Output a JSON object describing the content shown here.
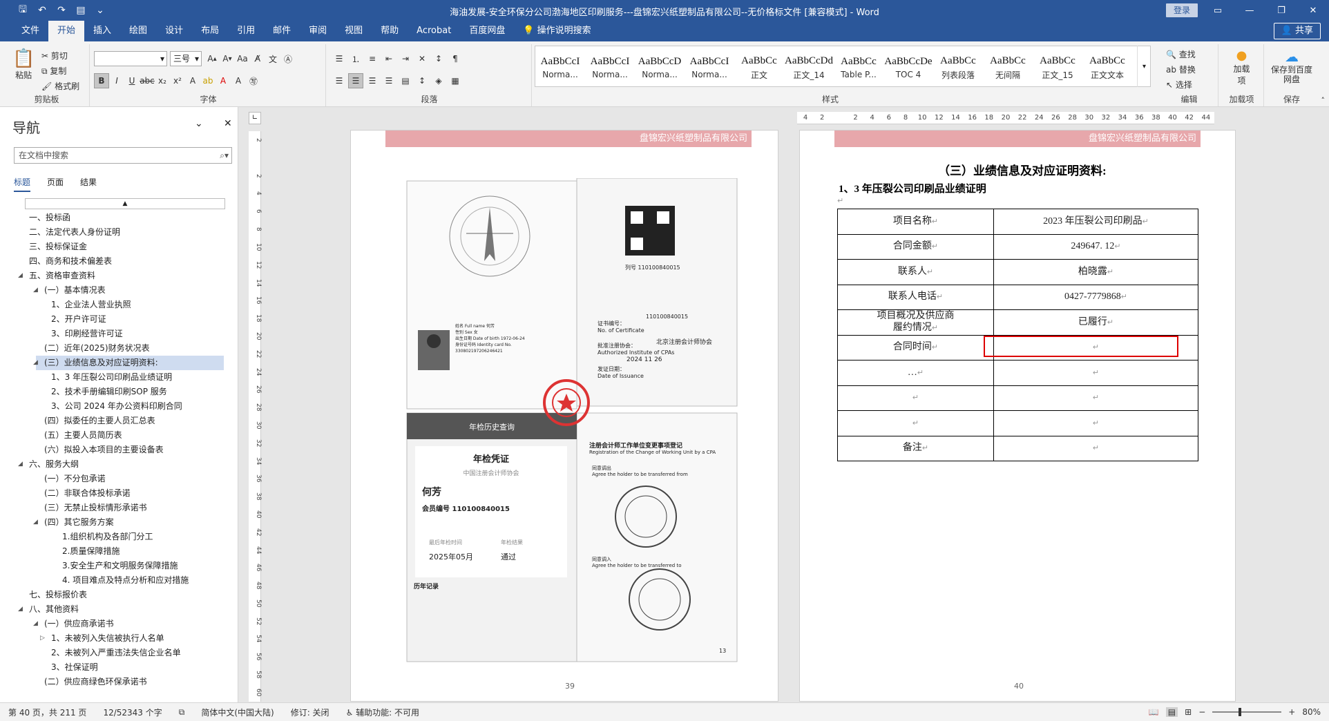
{
  "window": {
    "title": "海油发展-安全环保分公司渤海地区印刷服务---盘锦宏兴纸塑制品有限公司--无价格标文件 [兼容模式]  -  Word",
    "login_label": "登录"
  },
  "tabs": [
    "文件",
    "开始",
    "插入",
    "绘图",
    "设计",
    "布局",
    "引用",
    "邮件",
    "审阅",
    "视图",
    "帮助",
    "Acrobat",
    "百度网盘",
    "操作说明搜索"
  ],
  "share_label": "共享",
  "ribbon": {
    "clipboard": {
      "paste": "粘贴",
      "cut": "剪切",
      "copy": "复制",
      "format_painter": "格式刷",
      "label": "剪贴板"
    },
    "font": {
      "font_size": "三号",
      "label": "字体"
    },
    "paragraph": {
      "label": "段落"
    },
    "styles": {
      "label": "样式",
      "items": [
        {
          "preview": "AaBbCcI",
          "name": "Norma..."
        },
        {
          "preview": "AaBbCcI",
          "name": "Norma..."
        },
        {
          "preview": "AaBbCcD",
          "name": "Norma..."
        },
        {
          "preview": "AaBbCcI",
          "name": "Norma..."
        },
        {
          "preview": "AaBbCc",
          "name": "正文"
        },
        {
          "preview": "AaBbCcDd",
          "name": "正文_14"
        },
        {
          "preview": "AaBbCc",
          "name": "Table P..."
        },
        {
          "preview": "AaBbCcDe",
          "name": "TOC 4"
        },
        {
          "preview": "AaBbCc",
          "name": "列表段落"
        },
        {
          "preview": "AaBbCc",
          "name": "无间隔"
        },
        {
          "preview": "AaBbCc",
          "name": "正文_15"
        },
        {
          "preview": "AaBbCc",
          "name": "正文文本"
        }
      ]
    },
    "editing": {
      "find": "查找",
      "replace": "替换",
      "select": "选择",
      "label": "编辑"
    },
    "addins": {
      "addin": "加载项",
      "label": "加载项"
    },
    "baidu": {
      "save": "保存到百度网盘",
      "label": "保存"
    }
  },
  "nav": {
    "title": "导航",
    "search_placeholder": "在文档中搜索",
    "tabs": [
      "标题",
      "页面",
      "结果"
    ],
    "items": [
      {
        "text": "一、投标函",
        "level": 1,
        "tri": ""
      },
      {
        "text": "二、法定代表人身份证明",
        "level": 1,
        "tri": ""
      },
      {
        "text": "三、投标保证金",
        "level": 1,
        "tri": ""
      },
      {
        "text": "四、商务和技术偏差表",
        "level": 1,
        "tri": ""
      },
      {
        "text": "五、资格审查资料",
        "level": 1,
        "tri": "◢"
      },
      {
        "text": "(一）基本情况表",
        "level": 2,
        "tri": "◢"
      },
      {
        "text": "1、企业法人营业执照",
        "level": 3,
        "tri": ""
      },
      {
        "text": "2、开户许可证",
        "level": 3,
        "tri": ""
      },
      {
        "text": "3、印刷经营许可证",
        "level": 3,
        "tri": ""
      },
      {
        "text": "(二）近年(2025)财务状况表",
        "level": 2,
        "tri": ""
      },
      {
        "text": "(三）业绩信息及对应证明资料:",
        "level": 2,
        "tri": "◢",
        "selected": true
      },
      {
        "text": "1、3 年压裂公司印刷品业绩证明",
        "level": 3,
        "tri": ""
      },
      {
        "text": "2、技术手册编辑印刷SOP 服务",
        "level": 3,
        "tri": ""
      },
      {
        "text": "3、公司 2024 年办公资料印刷合同",
        "level": 3,
        "tri": ""
      },
      {
        "text": "(四）拟委任的主要人员汇总表",
        "level": 2,
        "tri": ""
      },
      {
        "text": "(五）主要人员简历表",
        "level": 2,
        "tri": ""
      },
      {
        "text": "(六）拟投入本项目的主要设备表",
        "level": 2,
        "tri": ""
      },
      {
        "text": "六、服务大纲",
        "level": 1,
        "tri": "◢"
      },
      {
        "text": "(一）不分包承诺",
        "level": 2,
        "tri": ""
      },
      {
        "text": "(二）非联合体投标承诺",
        "level": 2,
        "tri": ""
      },
      {
        "text": "(三）无禁止投标情形承诺书",
        "level": 2,
        "tri": ""
      },
      {
        "text": "(四）其它服务方案",
        "level": 2,
        "tri": "◢"
      },
      {
        "text": "1.组织机构及各部门分工",
        "level": 4,
        "tri": ""
      },
      {
        "text": "2.质量保障措施",
        "level": 4,
        "tri": ""
      },
      {
        "text": "3.安全生产和文明服务保障措施",
        "level": 4,
        "tri": ""
      },
      {
        "text": "4. 项目难点及特点分析和应对措施",
        "level": 4,
        "tri": ""
      },
      {
        "text": "七、投标报价表",
        "level": 1,
        "tri": ""
      },
      {
        "text": "八、其他资料",
        "level": 1,
        "tri": "◢"
      },
      {
        "text": "(一）供应商承诺书",
        "level": 2,
        "tri": "◢"
      },
      {
        "text": "1、未被列入失信被执行人名单",
        "level": 3,
        "tri": "▷"
      },
      {
        "text": "2、未被列入严重违法失信企业名单",
        "level": 3,
        "tri": ""
      },
      {
        "text": "3、社保证明",
        "level": 3,
        "tri": ""
      },
      {
        "text": "(二）供应商绿色环保承诺书",
        "level": 2,
        "tri": ""
      }
    ]
  },
  "ruler_numbers": [
    "4",
    "2",
    "",
    "2",
    "4",
    "6",
    "8",
    "10",
    "12",
    "14",
    "16",
    "18",
    "20",
    "22",
    "24",
    "26",
    "28",
    "30",
    "32",
    "34",
    "36",
    "38",
    "40",
    "42",
    "44"
  ],
  "vruler_numbers": [
    "2",
    "",
    "2",
    "4",
    "6",
    "8",
    "10",
    "12",
    "14",
    "16",
    "18",
    "20",
    "22",
    "24",
    "26",
    "28",
    "30",
    "32",
    "34",
    "36",
    "38",
    "40",
    "42",
    "44",
    "46",
    "48",
    "50",
    "52",
    "54",
    "56",
    "58",
    "60"
  ],
  "page_left": {
    "header": "盘锦宏兴纸塑制品有限公司",
    "page_number": "39",
    "cert": {
      "qr_no": "列号  110100840015",
      "cert_no_label": "证书编号：",
      "cert_no_en": "No. of Certificate",
      "cert_no": "110100840015",
      "approval_label": "批准注册协会：",
      "approval_en": "Authorized Institute of CPAs",
      "approval_org": "北京注册会计师协会",
      "issue_label": "发证日期：",
      "issue_en": "Date of Issuance",
      "issue_date": "2024   11   26",
      "name_label": "姓名 Full name",
      "name": "何芳",
      "sex_label": "性别 Sex",
      "sex": "女",
      "birth_label": "出生日期 Date of birth",
      "birth": "1972-06-24",
      "id_label": "身份证号码 Identity card No.",
      "id": "330802197206246421",
      "review_header": "年检历史查询",
      "review_title": "年检凭证",
      "review_org": "中国注册会计师协会",
      "review_name": "何芳",
      "review_member_no": "会员编号  110100840015",
      "review_last_label": "最后年检时间",
      "review_last": "2025年05月",
      "review_result_label": "年检结果",
      "review_result": "通过",
      "review_history": "历年记录",
      "change_title": "注册会计师工作单位变更事项登记",
      "change_title_en": "Registration of the Change of Working Unit by a CPA",
      "change_agree": "同意调出",
      "change_agree_en": "Agree the holder to be transferred from",
      "change_in": "同意调入",
      "change_in_en": "Agree the holder to be transferred to",
      "page_mark": "13"
    }
  },
  "page_right": {
    "header": "盘锦宏兴纸塑制品有限公司",
    "section_title": "（三）业绩信息及对应证明资料:",
    "subtitle": "1、3 年压裂公司印刷品业绩证明",
    "page_number": "40",
    "table": [
      [
        "项目名称",
        "2023  年压裂公司印刷品"
      ],
      [
        "合同金额",
        "249647. 12"
      ],
      [
        "联系人",
        "柏晓露"
      ],
      [
        "联系人电话",
        "0427-7779868"
      ],
      [
        "项目概况及供应商\n履约情况",
        "已履行"
      ],
      [
        "合同时间",
        ""
      ],
      [
        "…",
        ""
      ],
      [
        "",
        ""
      ],
      [
        "",
        ""
      ],
      [
        "备注",
        ""
      ]
    ]
  },
  "status": {
    "page": "第 40 页，共 211 页",
    "words": "12/52343 个字",
    "lang": "简体中文(中国大陆)",
    "track": "修订: 关闭",
    "access": "辅助功能: 不可用",
    "zoom": "80%"
  },
  "colors": {
    "accent": "#2b579a",
    "header_band": "#e7a7ab",
    "highlight": "#dd0000"
  }
}
